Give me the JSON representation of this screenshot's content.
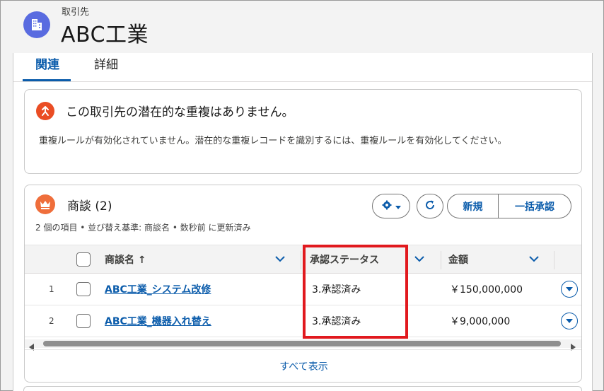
{
  "record": {
    "object_label": "取引先",
    "title": "ABC工業",
    "icon": "building-icon"
  },
  "tabs": [
    {
      "label": "関連",
      "active": true
    },
    {
      "label": "詳細",
      "active": false
    }
  ],
  "duplicates": {
    "title": "この取引先の潜在的な重複はありません。",
    "message": "重複ルールが有効化されていません。潜在的な重複レコードを識別するには、重複ルールを有効化してください。",
    "icon": "merge-icon"
  },
  "opportunities": {
    "title": "商談 (2)",
    "meta": "2 個の項目 • 並び替え基準: 商談名 • 数秒前 に更新済み",
    "icon": "crown-icon",
    "buttons": {
      "new": "新規",
      "bulk_approve": "一括承認"
    },
    "columns": {
      "name": "商談名 ↑",
      "status": "承認ステータス",
      "amount": "金額"
    },
    "rows": [
      {
        "num": "1",
        "name": "ABC工業_システム改修",
        "status": "3.承認済み",
        "amount": "￥150,000,000"
      },
      {
        "num": "2",
        "name": "ABC工業_機器入れ替え",
        "status": "3.承認済み",
        "amount": "￥9,000,000"
      }
    ],
    "view_all": "すべて表示"
  },
  "colors": {
    "brand_blue": "#0b5cab",
    "account_icon": "#596be0",
    "highlight_red": "#e1191e"
  }
}
